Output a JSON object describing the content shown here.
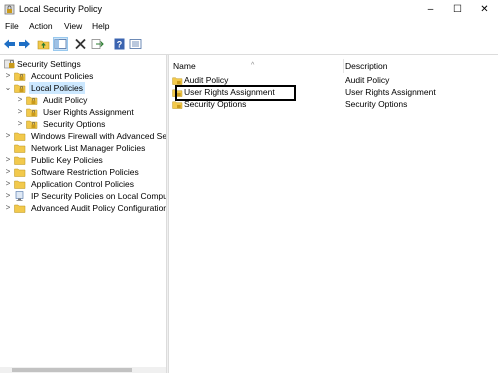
{
  "window": {
    "title": "Local Security Policy",
    "icon": "security-policy-icon",
    "controls": {
      "minimize": "–",
      "maximize": "☐",
      "close": "✕"
    }
  },
  "menu": [
    "File",
    "Action",
    "View",
    "Help"
  ],
  "toolbar": [
    "back-arrow-icon",
    "forward-arrow-icon",
    "up-folder-icon",
    "show-hide-tree-icon",
    "delete-icon",
    "export-list-icon",
    "help-icon",
    "properties-icon"
  ],
  "tree": {
    "root": "Security Settings",
    "items": [
      {
        "label": "Account Policies",
        "icon": "folder-lock-icon",
        "expanded": false,
        "level": 1
      },
      {
        "label": "Local Policies",
        "icon": "folder-lock-icon",
        "expanded": true,
        "level": 1,
        "selected": true
      },
      {
        "label": "Audit Policy",
        "icon": "folder-lock-icon",
        "level": 2
      },
      {
        "label": "User Rights Assignment",
        "icon": "folder-lock-icon",
        "level": 2
      },
      {
        "label": "Security Options",
        "icon": "folder-lock-icon",
        "level": 2
      },
      {
        "label": "Windows Firewall with Advanced Sec",
        "icon": "folder-icon",
        "level": 1
      },
      {
        "label": "Network List Manager Policies",
        "icon": "folder-icon",
        "level": 1
      },
      {
        "label": "Public Key Policies",
        "icon": "folder-icon",
        "level": 1
      },
      {
        "label": "Software Restriction Policies",
        "icon": "folder-icon",
        "level": 1
      },
      {
        "label": "Application Control Policies",
        "icon": "folder-icon",
        "level": 1
      },
      {
        "label": "IP Security Policies on Local Compute",
        "icon": "ip-security-icon",
        "level": 1
      },
      {
        "label": "Advanced Audit Policy Configuration",
        "icon": "folder-icon",
        "level": 1
      }
    ]
  },
  "list": {
    "columns": {
      "name": "Name",
      "description": "Description"
    },
    "rows": [
      {
        "name": "Audit Policy",
        "description": "Audit Policy"
      },
      {
        "name": "User Rights Assignment",
        "description": "User Rights Assignment",
        "highlighted": true
      },
      {
        "name": "Security Options",
        "description": "Security Options"
      }
    ]
  },
  "colors": {
    "selection": "#cce8ff",
    "folder": "#f2c94c",
    "lock": "#c99a1b"
  }
}
